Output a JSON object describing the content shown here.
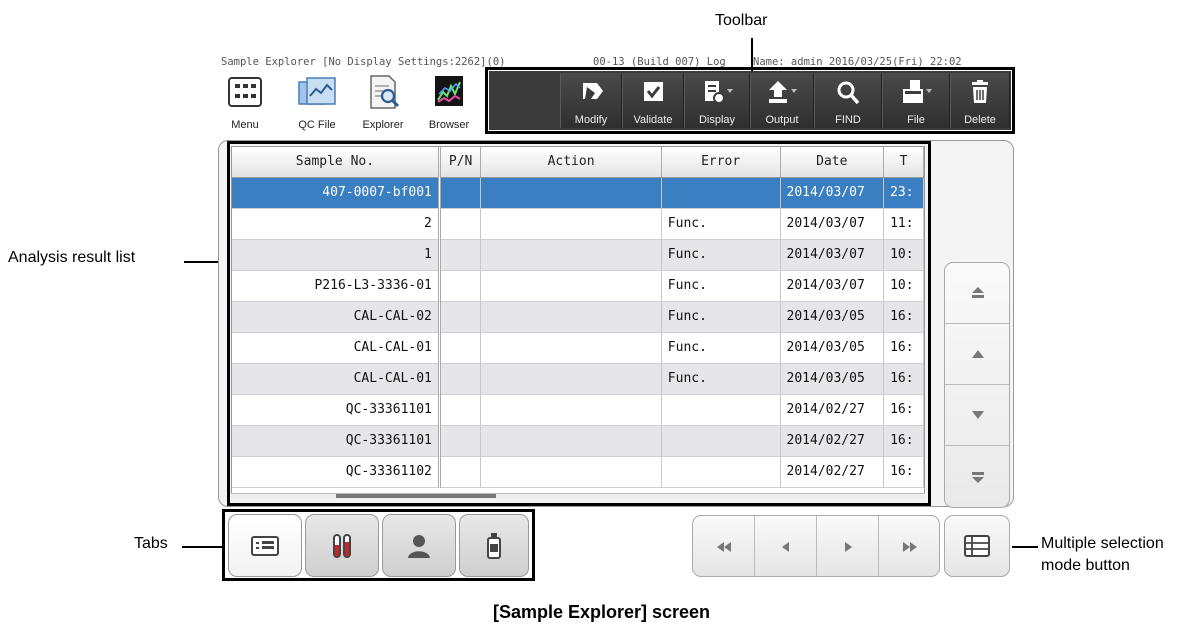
{
  "window": {
    "title": "Sample Explorer [No Display Settings:2262](0)",
    "build": "00-13 (Build 007) Log",
    "user": "Name: admin   2016/03/25(Fri) 22:02"
  },
  "launch": [
    {
      "label": "Menu",
      "icon": "menu-grid-icon"
    },
    {
      "label": "QC File",
      "icon": "qc-file-icon"
    },
    {
      "label": "Explorer",
      "icon": "explorer-icon"
    },
    {
      "label": "Browser",
      "icon": "browser-icon"
    }
  ],
  "toolbar": {
    "buttons": [
      {
        "label": "Modify",
        "icon": "modify-eraser-icon"
      },
      {
        "label": "Validate",
        "icon": "validate-check-icon"
      },
      {
        "label": "Display",
        "icon": "display-settings-icon"
      },
      {
        "label": "Output",
        "icon": "output-upload-icon"
      },
      {
        "label": "FIND",
        "icon": "find-search-icon"
      },
      {
        "label": "File",
        "icon": "file-icon"
      },
      {
        "label": "Delete",
        "icon": "delete-trash-icon"
      }
    ]
  },
  "table": {
    "columns": [
      "Sample No.",
      "P/N",
      "Action",
      "Error",
      "Date",
      "T"
    ],
    "rows": [
      [
        "407-0007-bf001",
        "",
        "",
        "",
        "2014/03/07",
        "23:"
      ],
      [
        "2",
        "",
        "",
        "Func.",
        "2014/03/07",
        "11:"
      ],
      [
        "1",
        "",
        "",
        "Func.",
        "2014/03/07",
        "10:"
      ],
      [
        "P216-L3-3336-01",
        "",
        "",
        "Func.",
        "2014/03/07",
        "10:"
      ],
      [
        "CAL-CAL-02",
        "",
        "",
        "Func.",
        "2014/03/05",
        "16:"
      ],
      [
        "CAL-CAL-01",
        "",
        "",
        "Func.",
        "2014/03/05",
        "16:"
      ],
      [
        "CAL-CAL-01",
        "",
        "",
        "Func.",
        "2014/03/05",
        "16:"
      ],
      [
        "QC-33361101",
        "",
        "",
        "",
        "2014/02/27",
        "16:"
      ],
      [
        "QC-33361101",
        "",
        "",
        "",
        "2014/02/27",
        "16:"
      ],
      [
        "QC-33361102",
        "",
        "",
        "",
        "2014/02/27",
        "16:"
      ]
    ],
    "selected_row": 0
  },
  "tabs": [
    {
      "icon": "sample-list-tab-icon"
    },
    {
      "icon": "test-tubes-tab-icon"
    },
    {
      "icon": "patient-tab-icon"
    },
    {
      "icon": "reagent-bottle-tab-icon"
    }
  ],
  "annotations": {
    "toolbar": "Toolbar",
    "list": "Analysis result list",
    "tabs": "Tabs",
    "multi_line1": "Multiple selection",
    "multi_line2": "mode button"
  },
  "caption": "[Sample Explorer] screen",
  "colors": {
    "selection": "#3a7fc2",
    "toolbar_bg": "#3b3b3b",
    "alt_row": "#e6e6ea"
  }
}
